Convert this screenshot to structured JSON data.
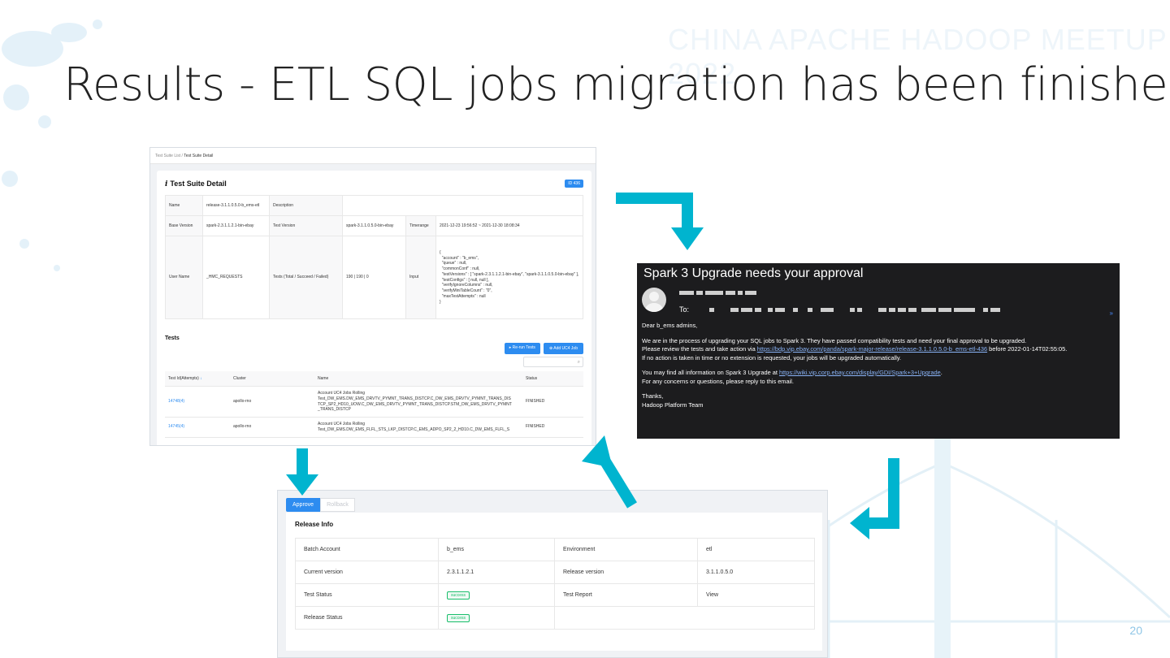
{
  "slide": {
    "watermark": "CHINA APACHE HADOOP MEETUP 2022",
    "title": "Results - ETL SQL jobs migration has been finished",
    "page_number": "20"
  },
  "colors": {
    "arrow": "#00b4cf",
    "primary_blue": "#2d8cf0",
    "success_green": "#19be6b",
    "email_bg": "#1c1c1e"
  },
  "test_suite": {
    "breadcrumb_root": "Test Suite List",
    "breadcrumb_sep": " / ",
    "breadcrumb_current": "Test Suite Detail",
    "icon": "info-icon",
    "title": "Test Suite Detail",
    "id_badge": "ID 436",
    "labels": {
      "name": "Name",
      "description": "Description",
      "base_version": "Base Version",
      "test_version": "Test Version",
      "timerange": "Timerange",
      "user_name": "User Name",
      "tests_total": "Tests (Total / Succeed / Failed)",
      "input": "Input"
    },
    "values": {
      "name": "release-3.1.1.0.5.0-b_ems-etl",
      "description": "",
      "base_version": "spark-2.3.1.1.2.1-bin-ebay",
      "test_version": "spark-3.1.1.0.5.0-bin-ebay",
      "timerange": "2021-12-23 19:56:52 ~ 2021-12-30 18:08:34",
      "user_name": "_HMC_REQUESTS",
      "tests_total": "190 | 190 | 0",
      "input": "{\n  \"account\" : \"b_ems\",\n  \"queue\" : null,\n  \"commonConf\" : null,\n  \"testVersions\" : [ \"spark-2.3.1.1.2.1-bin-ebay\", \"spark-3.1.1.0.5.0-bin-ebay\" ],\n  \"testConfigs\" : [ null, null ],\n  \"verifyIgnoreColumns\" : null,\n  \"verifyMiniTableCount\" : \"0\",\n  \"maxTestAttempts\" : null\n}"
    },
    "tests_title": "Tests",
    "rerun_button": "Re-run Tests",
    "add_job_button": "Add UC4 Job",
    "search_icon": "search-icon",
    "columns": [
      "Test Id(Attempts)",
      "Cluster",
      "Name",
      "Status"
    ],
    "rows": [
      {
        "id": "14748(4)",
        "cluster": "apollo-rno",
        "name": "Account UC4 Jobs Rolling\nTest_DW_EMS.DW_EMS_DRVTV_PYMNT_TRANS_DISTCP.C_DW_EMS_DRVTV_PYMNT_TRANS_DIS\nTCP_SP2_HD10_UOW.C_DW_EMS_DRVTV_PYMNT_TRANS_DISTCP.STM_DW_EMS_DRVTV_PYMNT\n_TRANS_DISTCP",
        "status": "FINISHED"
      },
      {
        "id": "14745(4)",
        "cluster": "apollo-rno",
        "name": "Account UC4 Jobs Rolling\nTest_DW_EMS.DW_EMS_FLFL_STS_LKP_DISTCP.C_EMS_ADPO_SP2_2_HD10.C_DW_EMS_FLFL_S",
        "status": "FINISHED"
      }
    ]
  },
  "email": {
    "subject": "Spark 3 Upgrade needs your approval",
    "to_label": "To:",
    "greeting": "Dear b_ems admins,",
    "para1_line1": "We are in the process of upgrading your SQL jobs to Spark 3. They have passed compatibility tests and need your final approval to be upgraded.",
    "para1_line2_pre": "Please review the tests and take action via ",
    "para1_link": "https://bdp.vip.ebay.com/panda/spark-major-release/release-3.1.1.0.5.0-b_ems-etl-436",
    "para1_line2_post": " before 2022-01-14T02:55:05.",
    "para1_line3": "If no action is taken in time or no extension is requested, your jobs will be upgraded automatically.",
    "para2_line1_pre": "You may find all information on Spark 3 Upgrade at ",
    "para2_link": "https://wiki.vip.corp.ebay.com/display/GDI/Spark+3+Upgrade",
    "para2_line1_post": ".",
    "para2_line2": "For any concerns or questions, please reply to this email.",
    "sign1": "Thanks,",
    "sign2": "Hadoop Platform Team",
    "expand_glyph": "»"
  },
  "release": {
    "approve_tab": "Approve",
    "rollback_tab": "Rollback",
    "title": "Release Info",
    "rows": [
      {
        "k1": "Batch Account",
        "v1": "b_ems",
        "k2": "Environment",
        "v2": "etl"
      },
      {
        "k1": "Current version",
        "v1": "2.3.1.1.2.1",
        "k2": "Release version",
        "v2": "3.1.1.0.5.0"
      },
      {
        "k1": "Test Status",
        "v1": "success",
        "k2": "Test Report",
        "v2": "View"
      },
      {
        "k1": "Release Status",
        "v1": "success",
        "k2": "",
        "v2": ""
      }
    ]
  }
}
